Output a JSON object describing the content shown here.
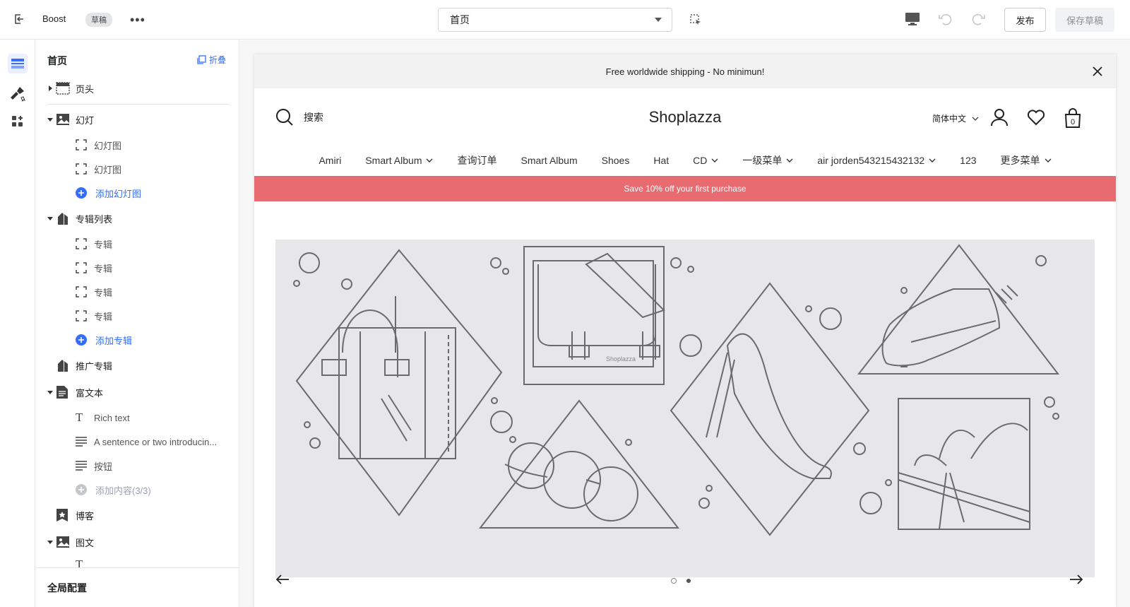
{
  "topbar": {
    "app_name": "Boost",
    "status_badge": "草稿",
    "page_select": "首页",
    "publish_label": "发布",
    "save_draft_label": "保存草稿"
  },
  "sidebar": {
    "title": "首页",
    "collapse_label": "折叠",
    "items": [
      {
        "label": "页头"
      },
      {
        "label": "幻灯"
      },
      {
        "label": "幻灯图"
      },
      {
        "label": "幻灯图"
      },
      {
        "label": "添加幻灯图"
      },
      {
        "label": "专辑列表"
      },
      {
        "label": "专辑"
      },
      {
        "label": "专辑"
      },
      {
        "label": "专辑"
      },
      {
        "label": "专辑"
      },
      {
        "label": "添加专辑"
      },
      {
        "label": "推广专辑"
      },
      {
        "label": "富文本"
      },
      {
        "label": "Rich text"
      },
      {
        "label": "A sentence or two introducin..."
      },
      {
        "label": "按钮"
      },
      {
        "label": "添加内容(3/3)"
      },
      {
        "label": "博客"
      },
      {
        "label": "图文"
      }
    ],
    "footer_label": "全局配置"
  },
  "preview": {
    "announcement": "Free worldwide shipping - No minimun!",
    "search_label": "搜索",
    "store_name": "Shoplazza",
    "language": "简体中文",
    "cart_count": "0",
    "nav": [
      "Amiri",
      "Smart Album",
      "查询订单",
      "Smart Album",
      "Shoes",
      "Hat",
      "CD",
      "一级菜单",
      "air jorden543215432132",
      "123",
      "更多菜单"
    ],
    "nav_dropdowns": [
      false,
      true,
      false,
      false,
      false,
      false,
      true,
      true,
      true,
      false,
      true
    ],
    "promo_bar": "Save 10% off your first purchase",
    "bag_brand": "Shoplazza",
    "slide_count": 2,
    "active_slide": 2
  },
  "colors": {
    "accent": "#356dff",
    "promo": "#e96b72"
  }
}
